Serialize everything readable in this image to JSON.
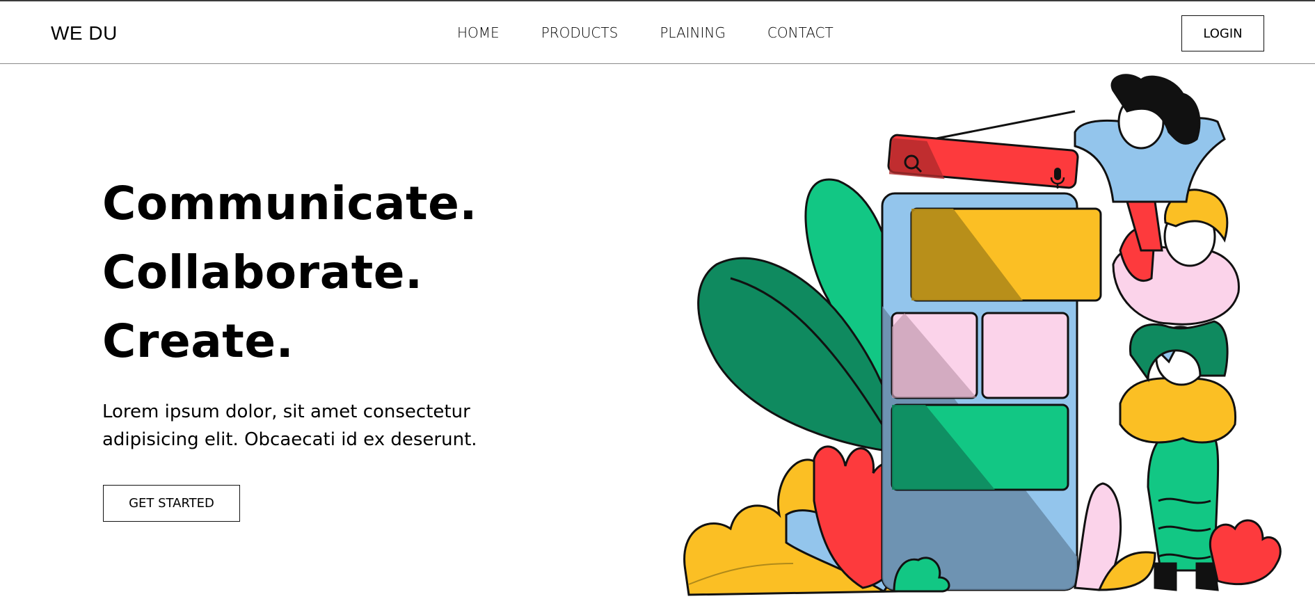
{
  "brand": {
    "logo_text": "WE DU"
  },
  "nav": {
    "items": [
      {
        "label": "HOME"
      },
      {
        "label": "PRODUCTS"
      },
      {
        "label": "PLAINING"
      },
      {
        "label": "CONTACT"
      }
    ],
    "login_label": "LOGIN"
  },
  "hero": {
    "line1": "Communicate.",
    "line2": "Collaborate.",
    "line3": "Create.",
    "description": "Lorem ipsum dolor, sit amet consectetur adipisicing elit. Obcaecati id ex deserunt.",
    "cta_label": "GET STARTED"
  },
  "colors": {
    "green": "#0f8a5f",
    "light_green": "#12c784",
    "yellow": "#fbbf24",
    "red": "#fd3a3d",
    "pink": "#fbd3ea",
    "blue": "#93c5ec",
    "dark": "#111111"
  },
  "icons": [
    "search-icon",
    "microphone-icon"
  ]
}
